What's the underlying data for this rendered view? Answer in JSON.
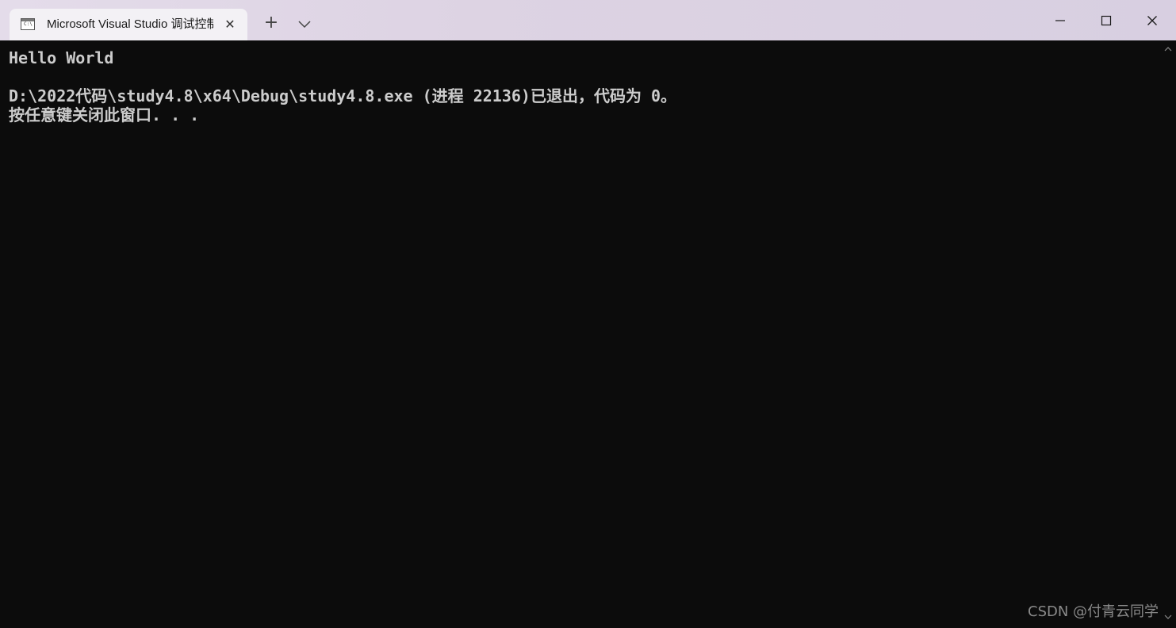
{
  "window": {
    "tab_title": "Microsoft Visual Studio 调试控制台",
    "tab_icon_text": "C:\\",
    "icons": {
      "tab": "console-app-icon",
      "close_tab": "close-icon",
      "new_tab": "plus-icon",
      "dropdown": "chevron-down-icon",
      "minimize": "minimize-icon",
      "maximize": "maximize-icon",
      "close": "close-icon"
    },
    "new_tab_glyph": "+",
    "close_tab_glyph": "✕"
  },
  "console": {
    "lines": [
      "Hello World",
      "",
      "D:\\2022代码\\study4.8\\x64\\Debug\\study4.8.exe (进程 22136)已退出，代码为 0。",
      "按任意键关闭此窗口. . ."
    ]
  },
  "watermark": "CSDN @付青云同学",
  "colors": {
    "console_bg": "#0c0c0c",
    "console_text": "#cccccc",
    "titlebar": "#ddd3e3",
    "tab_bg": "#f3f1f5"
  }
}
